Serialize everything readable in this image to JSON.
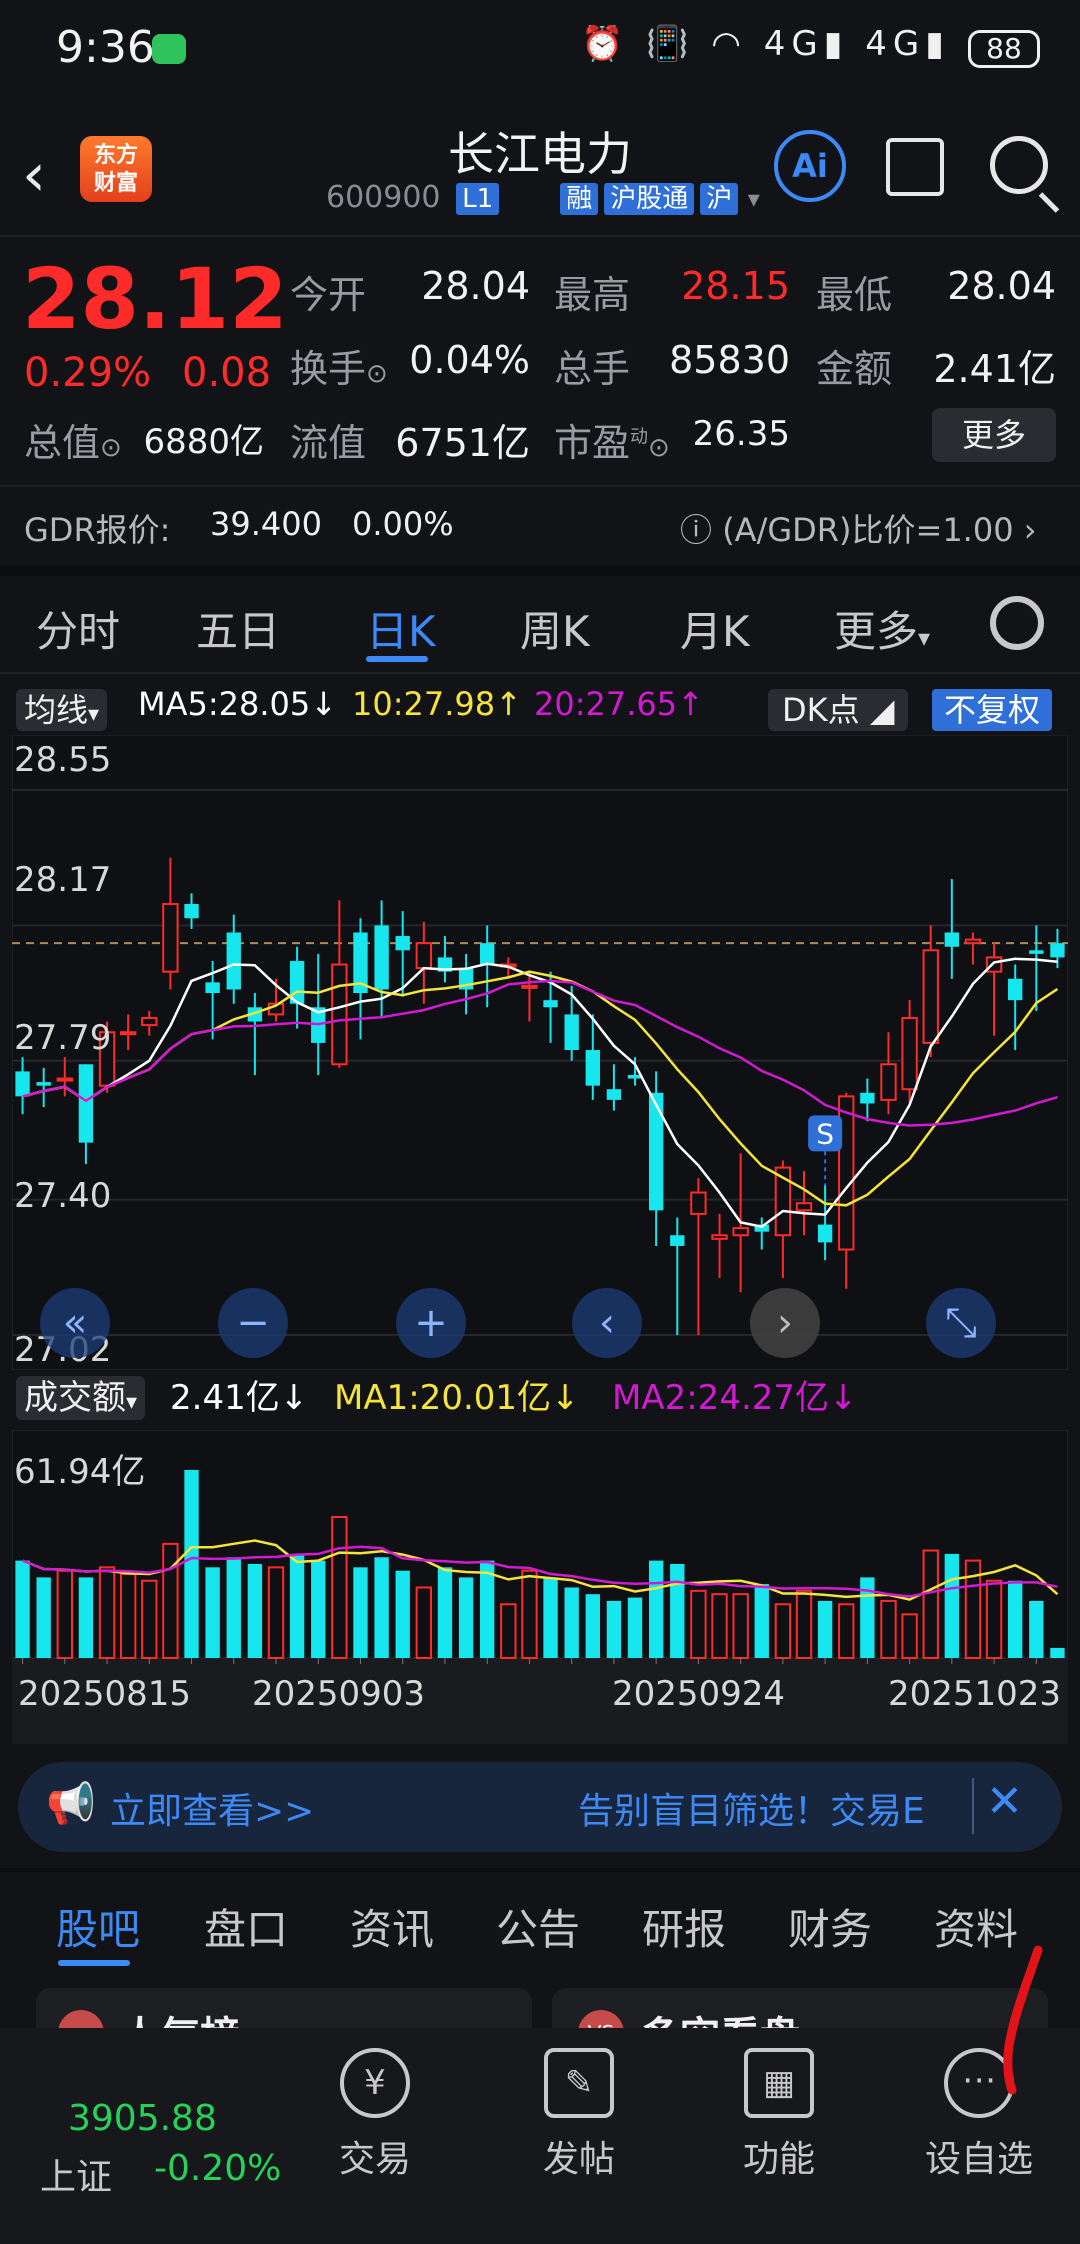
{
  "status_bar": {
    "time": "9:36",
    "battery": "88",
    "network": "4G",
    "network2": "4G"
  },
  "header": {
    "title": "长江电力",
    "code": "600900",
    "level": "L1",
    "tags": [
      "融",
      "沪股通",
      "沪"
    ],
    "logo_line1": "东方",
    "logo_line2": "财富",
    "ai_label": "Ai"
  },
  "quote": {
    "price": "28.12",
    "change_pct": "0.29%",
    "change": "0.08",
    "rows": [
      [
        {
          "label": "今开",
          "value": "28.04",
          "color": "#f2f2f2"
        },
        {
          "label": "最高",
          "value": "28.15",
          "color": "#ff2b2b"
        },
        {
          "label": "最低",
          "value": "28.04",
          "color": "#f2f2f2"
        }
      ],
      [
        {
          "label": "换手",
          "value": "0.04%",
          "color": "#f2f2f2"
        },
        {
          "label": "总手",
          "value": "85830",
          "color": "#f2f2f2"
        },
        {
          "label": "金额",
          "value": "2.41亿",
          "color": "#f2f2f2"
        }
      ],
      [
        {
          "label": "流值",
          "value": "6751亿",
          "color": "#f2f2f2"
        },
        {
          "label": "市盈",
          "value": "26.35",
          "color": "#f2f2f2"
        }
      ]
    ],
    "market_cap_label": "总值",
    "market_cap": "6880亿",
    "pe_superscript": "动",
    "more_label": "更多",
    "gdr_label": "GDR报价:",
    "gdr_price": "39.400",
    "gdr_pct": "0.00%",
    "gdr_ratio": "(A/GDR)比价=1.00"
  },
  "period_tabs": [
    "分时",
    "五日",
    "日K",
    "周K",
    "月K",
    "更多"
  ],
  "active_period": "日K",
  "ma_row": {
    "label": "均线",
    "ma5": "MA5:28.05↓",
    "ma10": "10:27.98↑",
    "ma20": "20:27.65↑",
    "dk": "DK点",
    "fq": "不复权"
  },
  "colors": {
    "up": "#ff2b2b",
    "down": "#16e6ee",
    "ma5": "#ffffff",
    "ma10": "#f5e43b",
    "ma20": "#d21ad2",
    "accent": "#3d8af7"
  },
  "chart_data": {
    "type": "candlestick",
    "title": "",
    "ylim": [
      27.02,
      28.55
    ],
    "yticks": [
      "28.55",
      "28.17",
      "27.79",
      "27.40",
      "27.02"
    ],
    "reference_price": 28.12,
    "x_dates": [
      "20250815",
      "20250903",
      "20250924",
      "20251023"
    ],
    "signal": "S",
    "candles": [
      [
        27.76,
        27.69,
        27.8,
        27.64
      ],
      [
        27.73,
        27.72,
        27.77,
        27.66
      ],
      [
        27.74,
        27.74,
        27.8,
        27.69
      ],
      [
        27.78,
        27.56,
        27.78,
        27.5
      ],
      [
        27.72,
        27.87,
        27.9,
        27.7
      ],
      [
        27.87,
        27.87,
        27.92,
        27.82
      ],
      [
        27.89,
        27.91,
        27.93,
        27.86
      ],
      [
        28.04,
        28.23,
        28.36,
        27.99
      ],
      [
        28.23,
        28.19,
        28.26,
        28.16
      ],
      [
        28.01,
        27.98,
        28.07,
        27.85
      ],
      [
        28.15,
        27.99,
        28.2,
        27.95
      ],
      [
        27.94,
        27.9,
        27.98,
        27.75
      ],
      [
        27.92,
        27.95,
        28.02,
        27.9
      ],
      [
        28.07,
        27.95,
        28.11,
        27.88
      ],
      [
        27.94,
        27.84,
        28.09,
        27.75
      ],
      [
        27.78,
        28.06,
        28.24,
        27.77
      ],
      [
        28.15,
        27.98,
        28.19,
        27.85
      ],
      [
        28.17,
        27.99,
        28.24,
        27.91
      ],
      [
        28.14,
        28.1,
        28.21,
        27.97
      ],
      [
        28.05,
        28.12,
        28.18,
        27.95
      ],
      [
        28.08,
        28.04,
        28.14,
        28.01
      ],
      [
        28.05,
        27.99,
        28.09,
        27.92
      ],
      [
        28.12,
        28.06,
        28.17,
        27.94
      ],
      [
        28.06,
        28.06,
        28.08,
        28.02
      ],
      [
        28.0,
        28.0,
        28.04,
        27.9
      ],
      [
        27.96,
        27.94,
        28.04,
        27.84
      ],
      [
        27.92,
        27.82,
        28.0,
        27.79
      ],
      [
        27.82,
        27.72,
        27.92,
        27.68
      ],
      [
        27.71,
        27.68,
        27.78,
        27.65
      ],
      [
        27.75,
        27.74,
        27.8,
        27.72
      ],
      [
        27.7,
        27.37,
        27.76,
        27.27
      ],
      [
        27.3,
        27.27,
        27.35,
        27.02
      ],
      [
        27.36,
        27.42,
        27.46,
        27.02
      ],
      [
        27.29,
        27.3,
        27.36,
        27.18
      ],
      [
        27.3,
        27.32,
        27.53,
        27.14
      ],
      [
        27.33,
        27.31,
        27.35,
        27.26
      ],
      [
        27.3,
        27.49,
        27.51,
        27.18
      ],
      [
        27.37,
        27.39,
        27.48,
        27.3
      ],
      [
        27.33,
        27.28,
        27.44,
        27.23
      ],
      [
        27.26,
        27.69,
        27.7,
        27.15
      ],
      [
        27.7,
        27.67,
        27.74,
        27.62
      ],
      [
        27.68,
        27.78,
        27.87,
        27.64
      ],
      [
        27.71,
        27.91,
        27.96,
        27.67
      ],
      [
        27.84,
        28.1,
        28.17,
        27.8
      ],
      [
        28.15,
        28.11,
        28.3,
        28.02
      ],
      [
        28.12,
        28.13,
        28.15,
        28.06
      ],
      [
        28.04,
        28.08,
        28.12,
        27.86
      ],
      [
        28.02,
        27.96,
        28.06,
        27.82
      ],
      [
        28.1,
        28.09,
        28.17,
        27.93
      ],
      [
        28.12,
        28.08,
        28.16,
        28.05
      ]
    ]
  },
  "volume": {
    "label": "成交额",
    "value": "2.41亿↓",
    "ma1": "MA1:20.01亿↓",
    "ma2": "MA2:24.27亿↓",
    "max_label": "61.94亿",
    "values": [
      29,
      24,
      26,
      24,
      27,
      25,
      23,
      34,
      56,
      27,
      30,
      28,
      27,
      31,
      29,
      42,
      27,
      30,
      26,
      21,
      27,
      24,
      29,
      16,
      26,
      24,
      21,
      19,
      17,
      18,
      29,
      28,
      20,
      19,
      19,
      22,
      16,
      20,
      17,
      16,
      24,
      17,
      13,
      32,
      31,
      29,
      23,
      23,
      17,
      3
    ]
  },
  "banner": {
    "link_text": "立即查看>>",
    "scroll_text": "告别盲目筛选！交易E"
  },
  "bottom_tabs": [
    "股吧",
    "盘口",
    "资讯",
    "公告",
    "研报",
    "财务",
    "资料"
  ],
  "cards": [
    {
      "title": "人气榜"
    },
    {
      "title": "多空看盘"
    }
  ],
  "bottom_nav": {
    "index_value": "3905.88",
    "index_name": "上证",
    "index_change": "-0.20%",
    "items": [
      "交易",
      "发帖",
      "功能",
      "设自选"
    ]
  }
}
